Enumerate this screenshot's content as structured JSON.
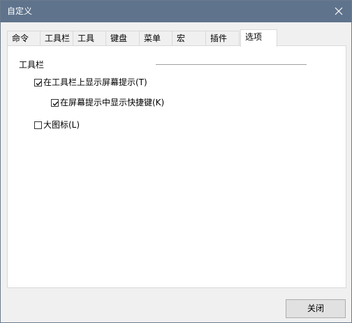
{
  "window": {
    "title": "自定义",
    "close_glyph": "close-icon"
  },
  "tabs": [
    {
      "label": "命令",
      "active": false
    },
    {
      "label": "工具栏",
      "active": false
    },
    {
      "label": "工具",
      "active": false
    },
    {
      "label": "键盘",
      "active": false
    },
    {
      "label": "菜单",
      "active": false
    },
    {
      "label": "宏",
      "active": false
    },
    {
      "label": "插件",
      "active": false
    },
    {
      "label": "选项",
      "active": true
    }
  ],
  "toolbar_group": {
    "label": "工具栏",
    "options": [
      {
        "label": "在工具栏上显示屏幕提示(T)",
        "checked": true
      },
      {
        "label": "在屏幕提示中显示快捷键(K)",
        "checked": true
      },
      {
        "label": "大图标(L)",
        "checked": false
      }
    ]
  },
  "buttons": {
    "close_label": "关闭"
  },
  "colors": {
    "titlebar": "#5f738c",
    "background": "#f0f0f0",
    "panel": "#ffffff"
  }
}
